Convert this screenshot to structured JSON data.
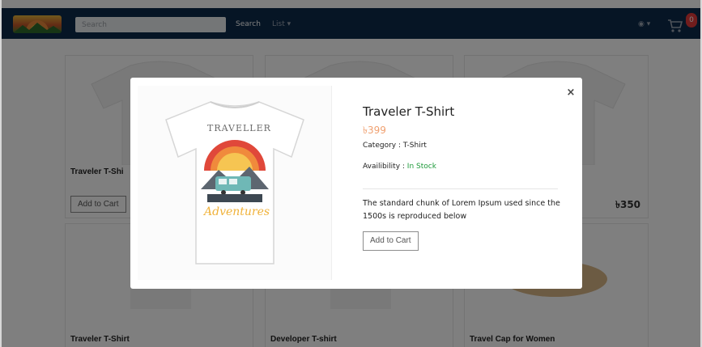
{
  "navbar": {
    "search_placeholder": "Search",
    "search_button": "Search",
    "list_menu": "List ▾",
    "user_menu": "◉ ▾",
    "cart_count": "0",
    "colors": {
      "bg": "#0d2a4a",
      "badge": "#e33b3b"
    }
  },
  "cards": [
    {
      "title": "Traveler T-Shi",
      "button": "Add to Cart"
    },
    {
      "price": "৳350"
    },
    {
      "title": "Traveler T-Shirt"
    },
    {
      "title": "Developer T-shirt"
    },
    {
      "title": "Travel Cap for Women"
    }
  ],
  "modal": {
    "title": "Traveler T-Shirt",
    "price": "৳399",
    "category": "Category : T-Shirt",
    "availability_label": "Availibility : ",
    "availability_value": "In Stock",
    "description": "The standard chunk of Lorem Ipsum used since the 1500s is reproduced below",
    "button": "Add to Cart",
    "close": "×",
    "shirt_print_top": "TRAVELLER",
    "shirt_print_bottom": "Adventures"
  },
  "colors": {
    "accent_price": "#f0a070",
    "in_stock": "#1e9a3a"
  }
}
